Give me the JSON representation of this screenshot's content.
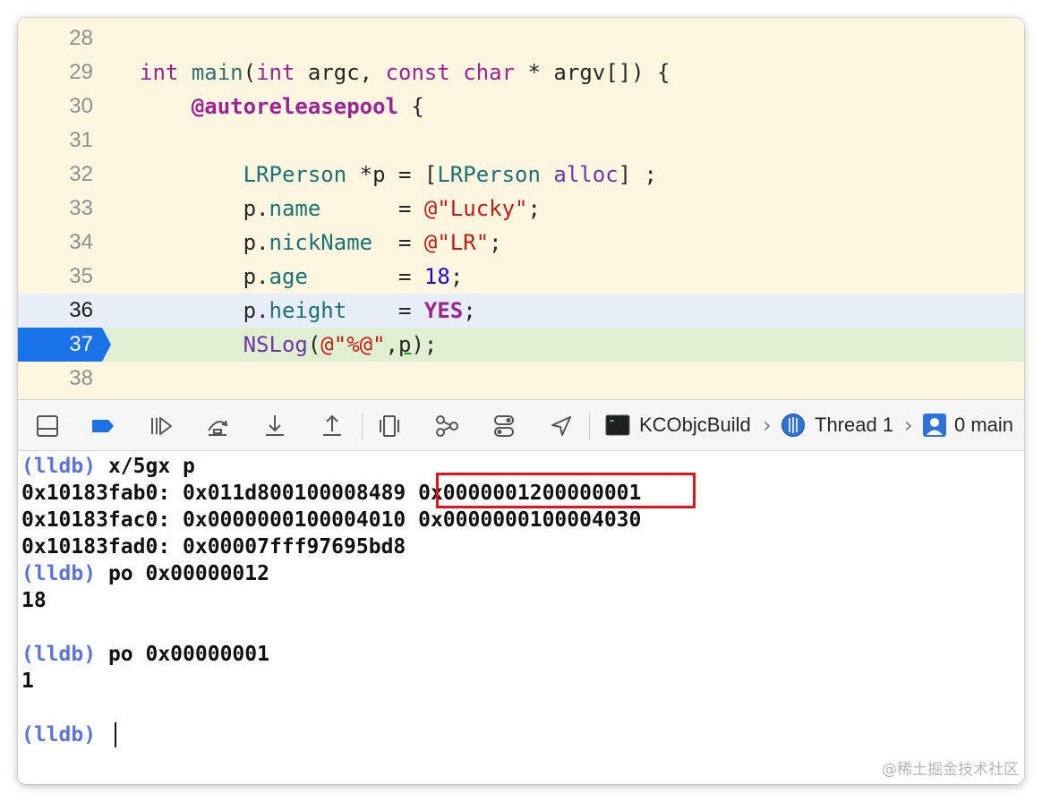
{
  "editor": {
    "lines": [
      {
        "num": "28",
        "parts": []
      },
      {
        "num": "29",
        "parts": [
          {
            "t": "int",
            "c": "kw"
          },
          {
            "t": " "
          },
          {
            "t": "main",
            "c": "fn"
          },
          {
            "t": "("
          },
          {
            "t": "int",
            "c": "kw"
          },
          {
            "t": " argc, "
          },
          {
            "t": "const",
            "c": "kw"
          },
          {
            "t": " "
          },
          {
            "t": "char",
            "c": "kw"
          },
          {
            "t": " * argv[]) {"
          }
        ]
      },
      {
        "num": "30",
        "parts": [
          {
            "t": "    "
          },
          {
            "t": "@autoreleasepool",
            "c": "kwb"
          },
          {
            "t": " {"
          }
        ]
      },
      {
        "num": "31",
        "parts": []
      },
      {
        "num": "32",
        "parts": [
          {
            "t": "        "
          },
          {
            "t": "LRPerson",
            "c": "cls"
          },
          {
            "t": " *p = ["
          },
          {
            "t": "LRPerson",
            "c": "cls"
          },
          {
            "t": " "
          },
          {
            "t": "alloc",
            "c": "mth"
          },
          {
            "t": "] ;"
          }
        ]
      },
      {
        "num": "33",
        "parts": [
          {
            "t": "        p."
          },
          {
            "t": "name",
            "c": "prop"
          },
          {
            "t": "      = "
          },
          {
            "t": "@\"Lucky\"",
            "c": "str"
          },
          {
            "t": ";"
          }
        ]
      },
      {
        "num": "34",
        "parts": [
          {
            "t": "        p."
          },
          {
            "t": "nickName",
            "c": "prop"
          },
          {
            "t": "  = "
          },
          {
            "t": "@\"LR\"",
            "c": "str"
          },
          {
            "t": ";"
          }
        ]
      },
      {
        "num": "35",
        "parts": [
          {
            "t": "        p."
          },
          {
            "t": "age",
            "c": "prop"
          },
          {
            "t": "       = "
          },
          {
            "t": "18",
            "c": "num"
          },
          {
            "t": ";"
          }
        ]
      },
      {
        "num": "36",
        "parts": [
          {
            "t": "        p."
          },
          {
            "t": "height",
            "c": "prop"
          },
          {
            "t": "    = "
          },
          {
            "t": "YES",
            "c": "kwb"
          },
          {
            "t": ";"
          }
        ]
      },
      {
        "num": "37",
        "parts": [
          {
            "t": "        "
          },
          {
            "t": "NSLog",
            "c": "mth"
          },
          {
            "t": "("
          },
          {
            "t": "@\"%@\"",
            "c": "str"
          },
          {
            "t": ","
          },
          {
            "t": "p",
            "c": "ul"
          },
          {
            "t": ");"
          }
        ]
      },
      {
        "num": "38",
        "parts": []
      }
    ]
  },
  "debugbar": {
    "scheme": "KCObjcBuild",
    "thread": "Thread 1",
    "frame": "0 main"
  },
  "console": {
    "lines": [
      {
        "prompt": "(lldb)",
        "text": " x/5gx p"
      },
      {
        "prompt": "",
        "text": "0x10183fab0: 0x011d800100008489 0x0000001200000001"
      },
      {
        "prompt": "",
        "text": "0x10183fac0: 0x0000000100004010 0x0000000100004030"
      },
      {
        "prompt": "",
        "text": "0x10183fad0: 0x00007fff97695bd8"
      },
      {
        "prompt": "(lldb)",
        "text": " po 0x00000012"
      },
      {
        "prompt": "",
        "text": "18"
      },
      {
        "prompt": "",
        "text": ""
      },
      {
        "prompt": "(lldb)",
        "text": " po 0x00000001"
      },
      {
        "prompt": "",
        "text": "1"
      },
      {
        "prompt": "",
        "text": ""
      },
      {
        "prompt": "(lldb)",
        "text": " "
      }
    ]
  },
  "watermark": "@稀土掘金技术社区",
  "colors": {
    "editor_bg": "#fdf7e0",
    "current_line": "#e7eef7",
    "breakpoint_line": "#e1efd1",
    "breakpoint": "#1a71e8",
    "lldb_prompt": "#5b74d6",
    "highlight_box": "#e2141b"
  }
}
